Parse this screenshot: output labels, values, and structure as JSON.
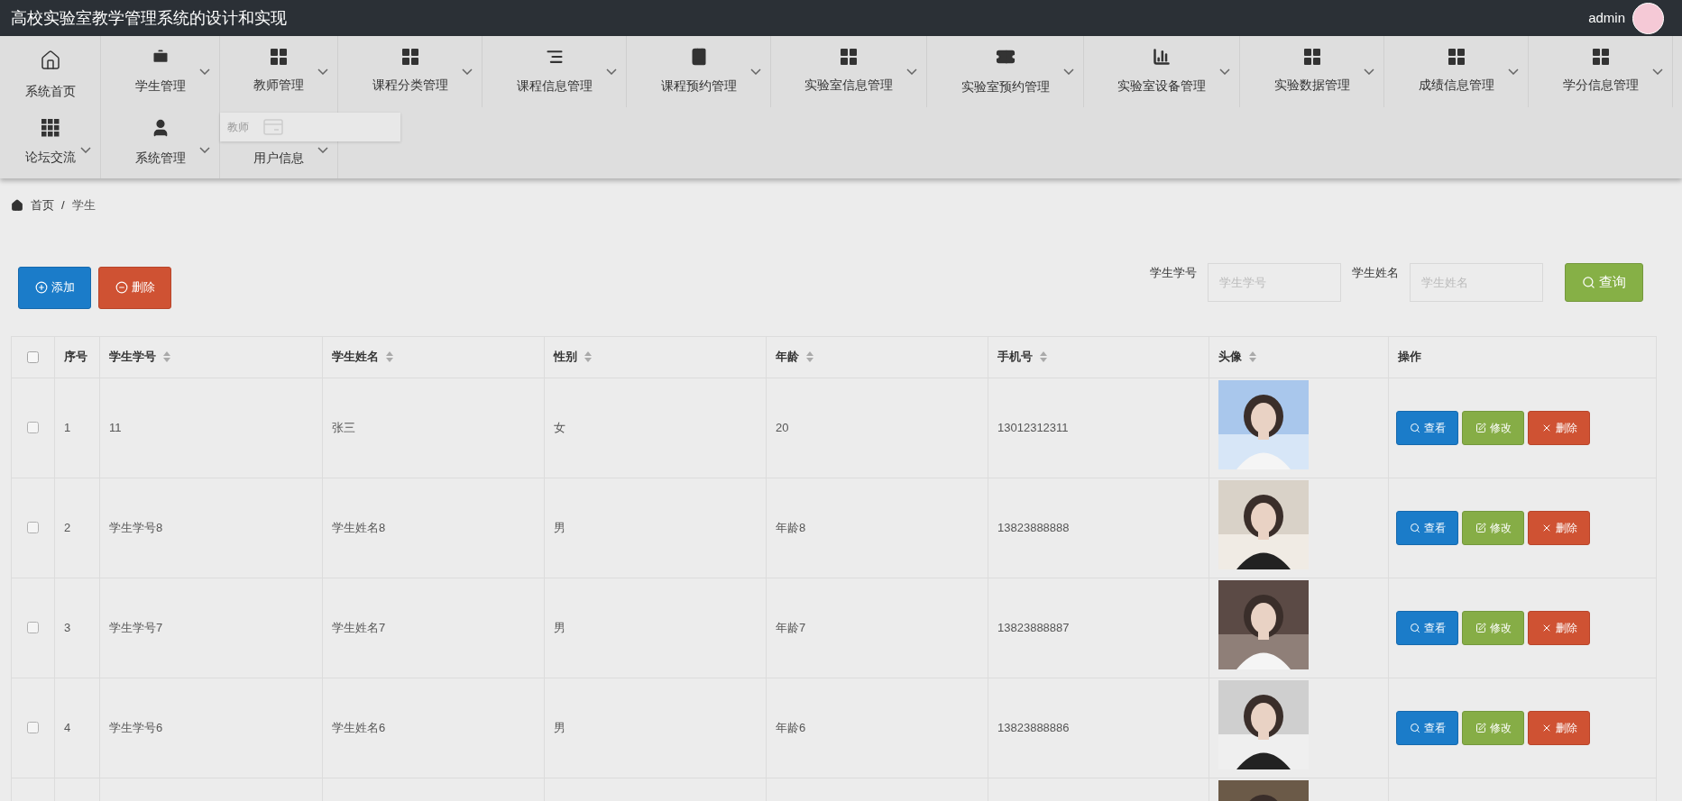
{
  "header": {
    "title": "高校实验室教学管理系统的设计和实现",
    "user": "admin"
  },
  "nav": {
    "rows": [
      [
        {
          "label": "系统首页",
          "kind": "link"
        },
        {
          "label": "学生管理",
          "kind": "dropdown"
        },
        {
          "label": "教师管理",
          "kind": "dropdown",
          "submenu": [
            "教师"
          ]
        },
        {
          "label": "课程分类管理",
          "kind": "dropdown"
        },
        {
          "label": "课程信息管理",
          "kind": "dropdown"
        },
        {
          "label": "课程预约管理",
          "kind": "dropdown"
        },
        {
          "label": "实验室信息管理",
          "kind": "dropdown"
        },
        {
          "label": "实验室预约管理",
          "kind": "dropdown"
        },
        {
          "label": "实验室设备管理",
          "kind": "dropdown"
        },
        {
          "label": "实验数据管理",
          "kind": "dropdown"
        },
        {
          "label": "成绩信息管理",
          "kind": "dropdown"
        },
        {
          "label": "学分信息管理",
          "kind": "dropdown"
        }
      ],
      [
        {
          "label": "论坛交流",
          "kind": "dropdown"
        },
        {
          "label": "系统管理",
          "kind": "dropdown"
        },
        {
          "label": "用户信息",
          "kind": "dropdown"
        }
      ]
    ]
  },
  "breadcrumb": [
    "首页",
    "/",
    "学生"
  ],
  "toolbar": {
    "buttons": [
      {
        "label": "添加",
        "kind": "add"
      },
      {
        "label": "删除",
        "kind": "delete"
      }
    ],
    "filters": [
      {
        "label": "学生学号",
        "placeholder": "学生学号"
      },
      {
        "label": "学生姓名",
        "placeholder": "学生姓名"
      }
    ],
    "search_button": "查询"
  },
  "table": {
    "select_all": {
      "checked": false
    },
    "columns": [
      {
        "label": "序号",
        "sortable": false
      },
      {
        "label": "学生学号",
        "sortable": true
      },
      {
        "label": "学生姓名",
        "sortable": true
      },
      {
        "label": "性别",
        "sortable": true
      },
      {
        "label": "年龄",
        "sortable": true
      },
      {
        "label": "手机号",
        "sortable": true
      },
      {
        "label": "头像",
        "sortable": true
      },
      {
        "label": "操作",
        "sortable": false
      }
    ],
    "rows": [
      {
        "checked": false,
        "cells": [
          "1",
          "11",
          "张三",
          "女",
          "20",
          "13012312311"
        ],
        "photo": {
          "kind": "picture"
        },
        "actions": [
          {
            "label": "查看",
            "kind": "view"
          },
          {
            "label": "修改",
            "kind": "edit"
          },
          {
            "label": "删除",
            "kind": "delete"
          }
        ]
      },
      {
        "checked": false,
        "cells": [
          "2",
          "学生学号8",
          "学生姓名8",
          "男",
          "年龄8",
          "13823888888"
        ],
        "photo": {
          "kind": "picture"
        },
        "actions": [
          {
            "label": "查看",
            "kind": "view"
          },
          {
            "label": "修改",
            "kind": "edit"
          },
          {
            "label": "删除",
            "kind": "delete"
          }
        ]
      },
      {
        "checked": false,
        "cells": [
          "3",
          "学生学号7",
          "学生姓名7",
          "男",
          "年龄7",
          "13823888887"
        ],
        "photo": {
          "kind": "picture"
        },
        "actions": [
          {
            "label": "查看",
            "kind": "view"
          },
          {
            "label": "修改",
            "kind": "edit"
          },
          {
            "label": "删除",
            "kind": "delete"
          }
        ]
      },
      {
        "checked": false,
        "cells": [
          "4",
          "学生学号6",
          "学生姓名6",
          "男",
          "年龄6",
          "13823888886"
        ],
        "photo": {
          "kind": "picture"
        },
        "actions": [
          {
            "label": "查看",
            "kind": "view"
          },
          {
            "label": "修改",
            "kind": "edit"
          },
          {
            "label": "删除",
            "kind": "delete"
          }
        ]
      },
      {
        "photo": {
          "kind": "picture"
        }
      }
    ]
  }
}
